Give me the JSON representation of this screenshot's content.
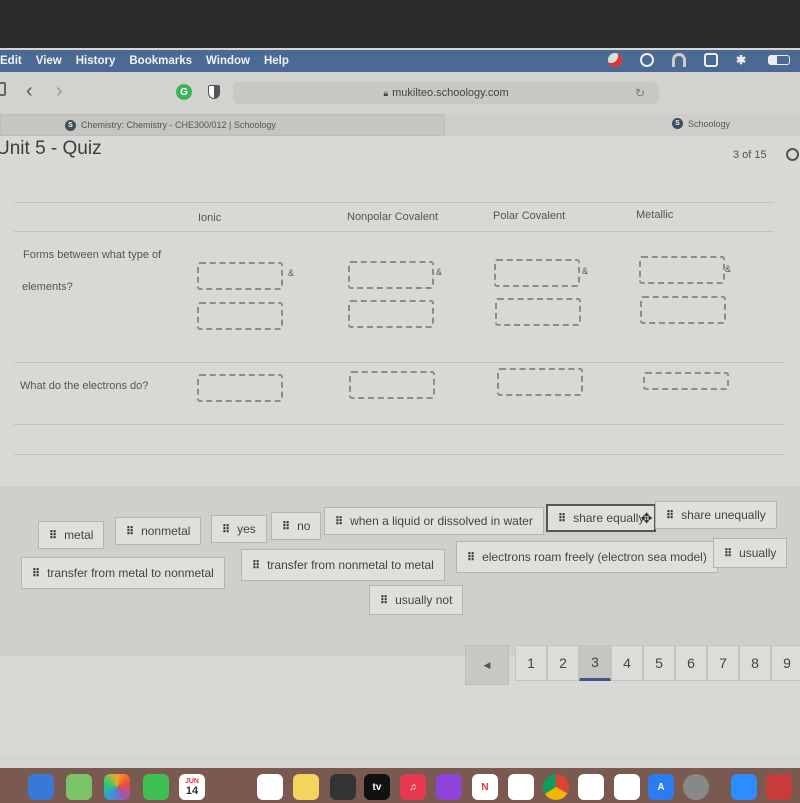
{
  "menubar": {
    "items": [
      "Edit",
      "View",
      "History",
      "Bookmarks",
      "Window",
      "Help"
    ],
    "tray_icons": [
      "creative-cloud-icon",
      "record-icon",
      "headphones-icon",
      "screen-mirror-icon",
      "bluetooth-icon",
      "battery-icon"
    ]
  },
  "browser": {
    "url": "mukilteo.schoology.com",
    "tabs": [
      {
        "label": "Chemistry: Chemistry - CHE300/012 | Schoology",
        "active": true
      },
      {
        "label": "Schoology",
        "active": false
      }
    ],
    "favicon_letter": "S"
  },
  "quiz": {
    "title": "Unit 5 - Quiz",
    "question_counter": "3 of 15",
    "columns": [
      "Ionic",
      "Nonpolar Covalent",
      "Polar Covalent",
      "Metallic"
    ],
    "rows": [
      {
        "label_line1": "Forms between what type of",
        "label_line2": "elements?"
      },
      {
        "label_line1": "What do the electrons do?"
      }
    ],
    "ampersand": "&",
    "answer_bank": [
      {
        "label": "metal"
      },
      {
        "label": "nonmetal"
      },
      {
        "label": "yes"
      },
      {
        "label": "no"
      },
      {
        "label": "when a liquid or dissolved in water"
      },
      {
        "label": "share equally",
        "selected": true
      },
      {
        "label": "share unequally"
      },
      {
        "label": "transfer from metal to nonmetal"
      },
      {
        "label": "transfer from nonmetal to metal"
      },
      {
        "label": "electrons roam freely (electron sea model)"
      },
      {
        "label": "usually"
      },
      {
        "label": "usually not"
      }
    ],
    "grip_glyph": "⠿",
    "pager": {
      "prev": "◀",
      "pages": [
        "1",
        "2",
        "3",
        "4",
        "5",
        "6",
        "7",
        "8",
        "9"
      ],
      "current": "3"
    }
  },
  "dock": {
    "calendar_month": "JUN",
    "calendar_day": "14",
    "tv_label": "tv"
  },
  "colors": {
    "menubar_bg": "#4a6a93",
    "current_page_underline": "#3a5a8a"
  }
}
